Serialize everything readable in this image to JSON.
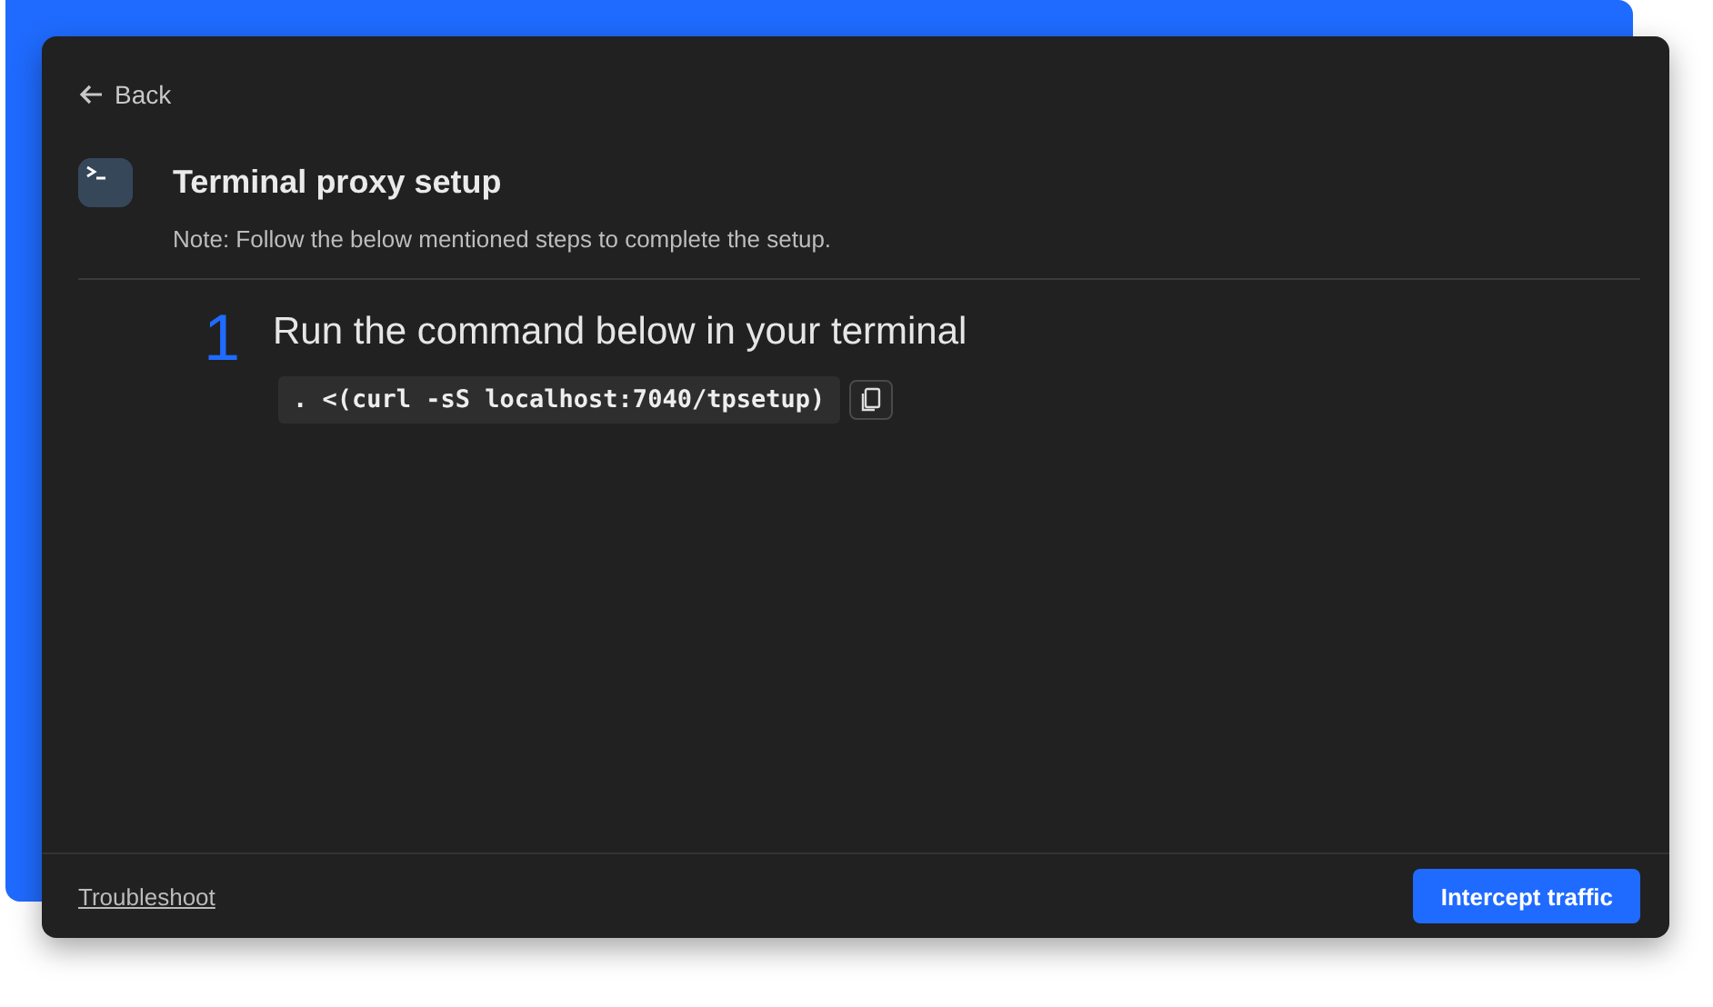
{
  "back_link": {
    "label": "Back"
  },
  "header": {
    "title": "Terminal proxy setup",
    "note": "Note: Follow the below mentioned steps to complete the setup."
  },
  "steps": [
    {
      "number": "1",
      "title": "Run the command below in your terminal",
      "command": ". <(curl -sS localhost:7040/tpsetup)"
    }
  ],
  "footer": {
    "link": "Troubleshoot",
    "button": "Intercept traffic"
  }
}
